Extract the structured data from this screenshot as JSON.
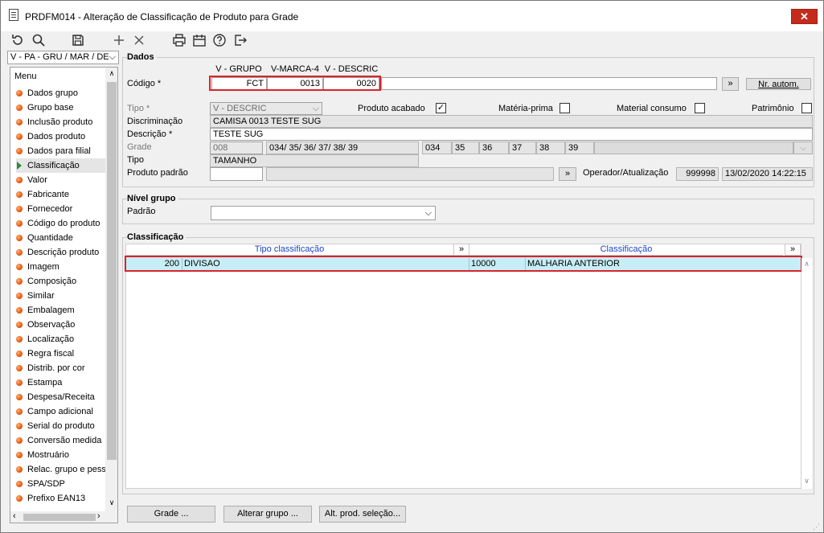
{
  "window": {
    "title": "PRDFM014 - Alteração de Classificação de Produto para Grade",
    "close_symbol": "✕"
  },
  "toolbar": {
    "icons": [
      "undo-icon",
      "search-icon",
      "save-icon",
      "add-icon",
      "delete-icon",
      "print-icon",
      "calendar-icon",
      "help-icon",
      "exit-icon"
    ]
  },
  "sidebar": {
    "selector": "V - PA - GRU / MAR / DE",
    "menu_header": "Menu",
    "items": [
      {
        "label": "Dados grupo"
      },
      {
        "label": "Grupo base"
      },
      {
        "label": "Inclusão produto"
      },
      {
        "label": "Dados produto"
      },
      {
        "label": "Dados para filial"
      },
      {
        "label": "Classificação"
      },
      {
        "label": "Valor"
      },
      {
        "label": "Fabricante"
      },
      {
        "label": "Fornecedor"
      },
      {
        "label": "Código do produto"
      },
      {
        "label": "Quantidade"
      },
      {
        "label": "Descrição produto"
      },
      {
        "label": "Imagem"
      },
      {
        "label": "Composição"
      },
      {
        "label": "Similar"
      },
      {
        "label": "Embalagem"
      },
      {
        "label": "Observação"
      },
      {
        "label": "Localização"
      },
      {
        "label": "Regra fiscal"
      },
      {
        "label": "Distrib. por cor"
      },
      {
        "label": "Estampa"
      },
      {
        "label": "Despesa/Receita"
      },
      {
        "label": "Campo adicional"
      },
      {
        "label": "Serial do produto"
      },
      {
        "label": "Conversão medida"
      },
      {
        "label": "Mostruário"
      },
      {
        "label": "Relac. grupo e pess"
      },
      {
        "label": "SPA/SDP"
      },
      {
        "label": "Prefixo EAN13"
      }
    ],
    "active_index": 5
  },
  "dados": {
    "title": "Dados",
    "col_headers": [
      "V - GRUPO",
      "V-MARCA-4",
      "V - DESCRIC"
    ],
    "codigo_label": "Código *",
    "codigo_values": [
      "FCT",
      "0013",
      "0020"
    ],
    "more_btn": "»",
    "nr_autom_btn": "Nr. autom.",
    "tipo_label": "Tipo *",
    "tipo_value": "V - DESCRIC",
    "produto_acabado_label": "Produto acabado",
    "produto_acabado_checked": "✓",
    "materia_prima_label": "Matéria-prima",
    "material_consumo_label": "Material consumo",
    "patrimonio_label": "Patrimônio",
    "discriminacao_label": "Discriminação",
    "discriminacao_value": "CAMISA 0013 TESTE SUG",
    "descricao_label": "Descrição *",
    "descricao_value": "TESTE SUG",
    "grade_label": "Grade",
    "grade_code": "008",
    "grade_sizes_text": "034/ 35/ 36/ 37/ 38/ 39",
    "grade_cells": [
      "034",
      "35",
      "36",
      "37",
      "38",
      "39"
    ],
    "tipo2_label": "Tipo",
    "tipo2_value": "TAMANHO",
    "produto_padrao_label": "Produto padrão",
    "operador_label": "Operador/Atualização",
    "operador_value": "999998",
    "atualizacao_value": "13/02/2020 14:22:15"
  },
  "nivel_grupo": {
    "title": "Nível grupo",
    "padrao_label": "Padrão",
    "padrao_value": ""
  },
  "classificacao": {
    "title": "Classificação",
    "col_tipo": "Tipo classificação",
    "col_classificacao": "Classificação",
    "rows": [
      {
        "tipo_code": "200",
        "tipo_desc": "DIVISAO",
        "class_code": "10000",
        "class_desc": "MALHARIA ANTERIOR"
      }
    ]
  },
  "footer": {
    "grade_btn": "Grade ...",
    "alterar_grupo_btn": "Alterar grupo ...",
    "alt_prod_btn": "Alt. prod. seleção..."
  }
}
